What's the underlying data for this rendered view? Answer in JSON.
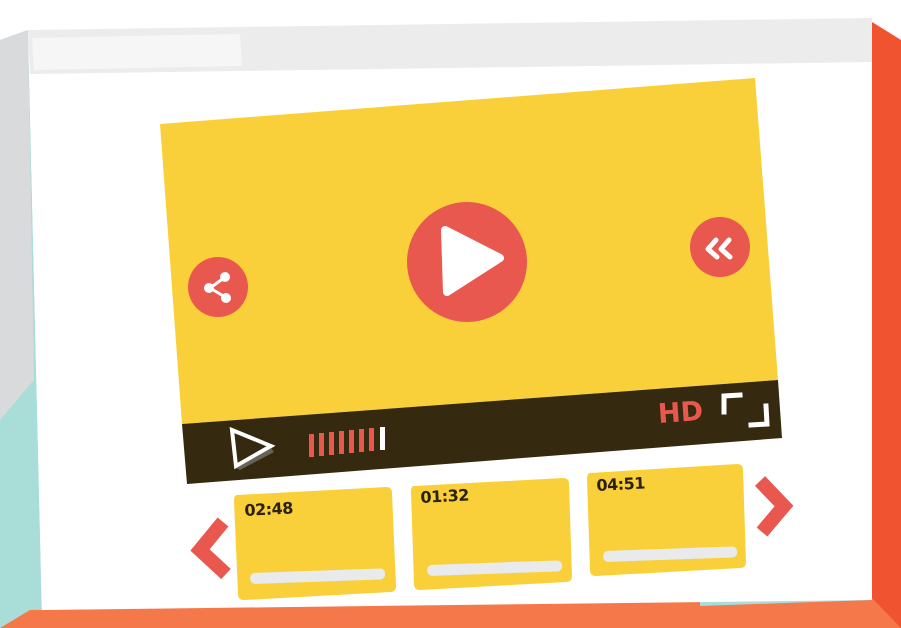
{
  "colors": {
    "screen_yellow": "#fad03a",
    "thumb_yellow": "#fad03a",
    "control_bar": "#35290f",
    "accent_red": "#e8584f",
    "frame_gray": "#e9eaeb",
    "frame_orange": "#f0532f",
    "bottom_orange": "#f4784a",
    "teal_shadow": "#a8ddd8",
    "white": "#ffffff"
  },
  "player": {
    "quality_label": "HD",
    "progress_ticks": 7,
    "icons": [
      "play-large-icon",
      "share-icon",
      "rewind-icon",
      "play-small-icon",
      "fullscreen-icon"
    ]
  },
  "thumbnails": [
    {
      "duration": "02:48"
    },
    {
      "duration": "01:32"
    },
    {
      "duration": "04:51"
    }
  ],
  "carousel": {
    "prev_icon": "chevron-left-icon",
    "next_icon": "chevron-right-icon"
  }
}
